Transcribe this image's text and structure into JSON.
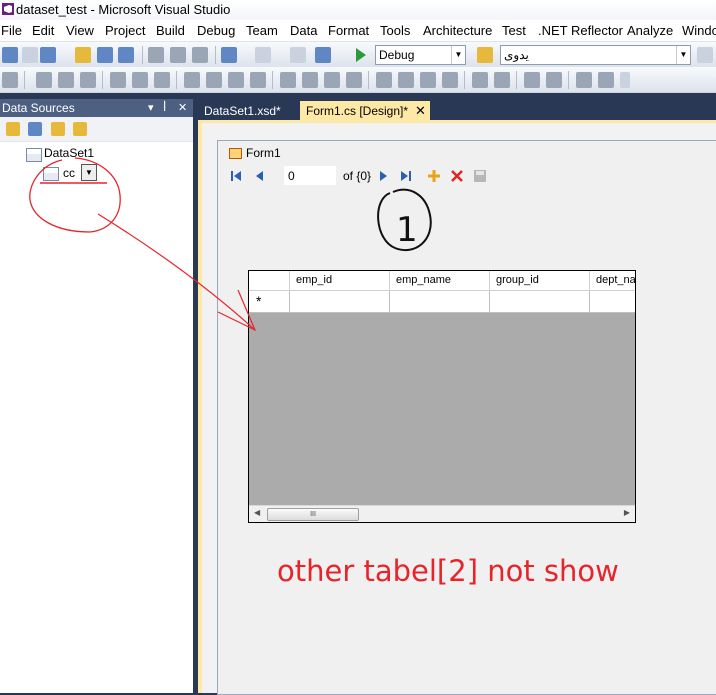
{
  "window": {
    "title": "dataset_test - Microsoft Visual Studio"
  },
  "menu": [
    "File",
    "Edit",
    "View",
    "Project",
    "Build",
    "Debug",
    "Team",
    "Data",
    "Format",
    "Tools",
    "Architecture",
    "Test",
    ".NET Reflector",
    "Analyze",
    "Windo"
  ],
  "toolbar": {
    "configuration": "Debug",
    "platform": "يدوى"
  },
  "data_sources": {
    "title": "Data Sources",
    "pin_glyph": "▾ ꟾ ✕",
    "dataset": "DataSet1",
    "table": "cc"
  },
  "tabs": [
    {
      "label": "DataSet1.xsd*",
      "active": false
    },
    {
      "label": "Form1.cs [Design]*",
      "active": true
    }
  ],
  "form": {
    "title": "Form1",
    "navigator": {
      "position": "0",
      "count": "of {0}"
    },
    "grid": {
      "columns": [
        "emp_id",
        "emp_name",
        "group_id",
        "dept_na"
      ],
      "new_row_marker": "*",
      "scroll_thumb": "III"
    }
  },
  "annotation": {
    "text": "other tabel[2] not show",
    "circled_number": "1",
    "color": "#e8242b"
  }
}
